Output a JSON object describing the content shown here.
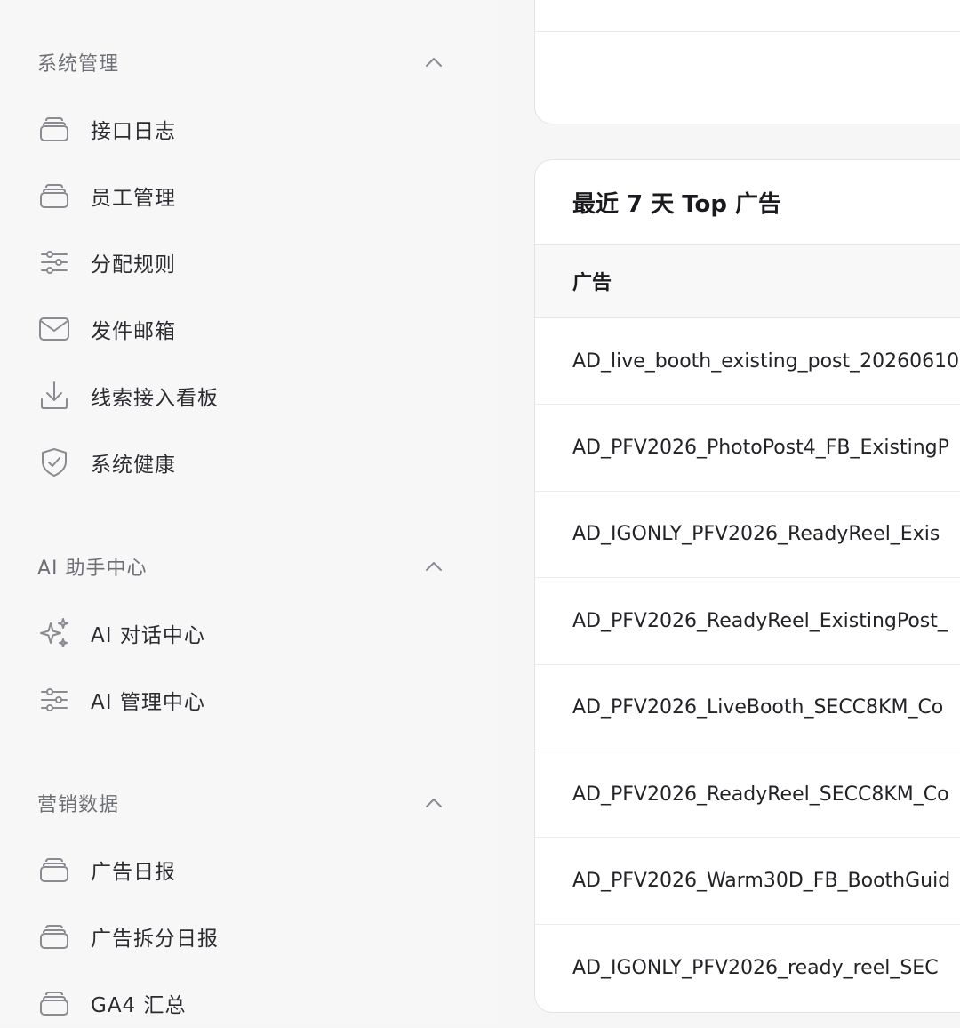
{
  "sidebar": {
    "sections": [
      {
        "title": "系统管理",
        "items": [
          {
            "label": "接口日志",
            "icon": "database-icon"
          },
          {
            "label": "员工管理",
            "icon": "database-icon"
          },
          {
            "label": "分配规则",
            "icon": "sliders-icon"
          },
          {
            "label": "发件邮箱",
            "icon": "mail-icon"
          },
          {
            "label": "线索接入看板",
            "icon": "download-icon"
          },
          {
            "label": "系统健康",
            "icon": "shield-check-icon"
          }
        ]
      },
      {
        "title": "AI 助手中心",
        "items": [
          {
            "label": "AI 对话中心",
            "icon": "sparkles-icon"
          },
          {
            "label": "AI 管理中心",
            "icon": "sliders-icon"
          }
        ]
      },
      {
        "title": "营销数据",
        "items": [
          {
            "label": "广告日报",
            "icon": "database-icon"
          },
          {
            "label": "广告拆分日报",
            "icon": "database-icon"
          },
          {
            "label": "GA4 汇总",
            "icon": "database-icon"
          }
        ]
      }
    ]
  },
  "ads_card": {
    "title": "最近 7 天 Top 广告",
    "column_header": "广告",
    "rows": [
      "AD_live_booth_existing_post_20260610",
      "AD_PFV2026_PhotoPost4_FB_ExistingP",
      "AD_IGONLY_PFV2026_ReadyReel_Exis",
      "AD_PFV2026_ReadyReel_ExistingPost_",
      "AD_PFV2026_LiveBooth_SECC8KM_Co",
      "AD_PFV2026_ReadyReel_SECC8KM_Co",
      "AD_PFV2026_Warm30D_FB_BoothGuid",
      "AD_IGONLY_PFV2026_ready_reel_SEC"
    ]
  }
}
